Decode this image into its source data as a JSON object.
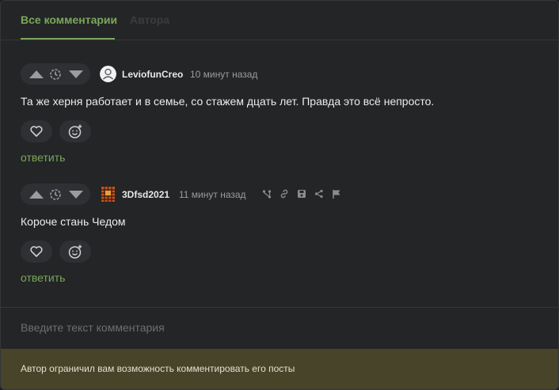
{
  "tabs": {
    "all_label": "Все комментарии",
    "author_label": "Автора"
  },
  "comments": [
    {
      "author": "LeviofunCreo",
      "time": "10 минут назад",
      "text": "Та же херня работает и в семье, со стажем дцать лет. Правда это всё непросто.",
      "reply_label": "ответить"
    },
    {
      "author": "3Dfsd2021",
      "time": "11 минут назад",
      "text": "Короче стань Чедом",
      "reply_label": "ответить"
    }
  ],
  "comment_input": {
    "placeholder": "Введите текст комментария"
  },
  "notice": {
    "text": "Автор ограничил вам возможность комментировать его посты"
  },
  "colors": {
    "accent": "#7aa85a",
    "background": "#242527",
    "notice_bg": "#48442a"
  }
}
